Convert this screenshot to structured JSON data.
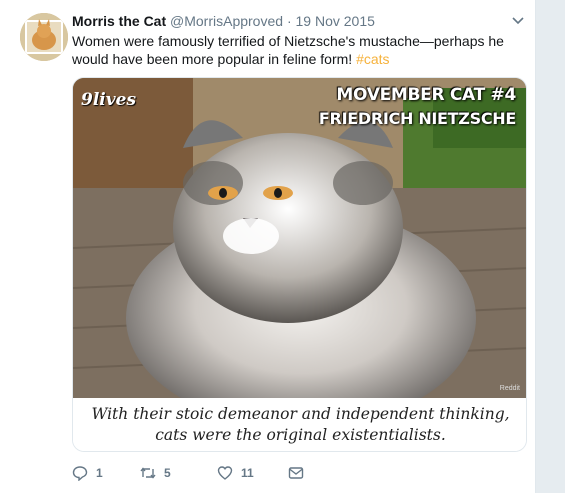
{
  "author": {
    "name": "Morris the Cat",
    "handle": "@MorrisApproved",
    "separator": "·",
    "date": "19 Nov 2015"
  },
  "tweet": {
    "text": "Women were famously terrified of Nietzsche's mustache—perhaps he would have been more popular in feline form!",
    "hashtag": "#cats"
  },
  "media": {
    "logo": "9lives",
    "title_line1": "MOVEMBER CAT #4",
    "title_line2": "FRIEDRICH NIETZSCHE",
    "credit": "Reddit",
    "caption_line1": "With their stoic demeanor and independent thinking,",
    "caption_line2": "cats were the original existentialists."
  },
  "actions": {
    "reply_count": "1",
    "retweet_count": "5",
    "like_count": "11"
  },
  "colors": {
    "hashtag": "#f6b23c",
    "secondary": "#657786"
  },
  "icons": [
    "chevron-down-icon",
    "reply-icon",
    "retweet-icon",
    "like-icon",
    "message-icon"
  ]
}
